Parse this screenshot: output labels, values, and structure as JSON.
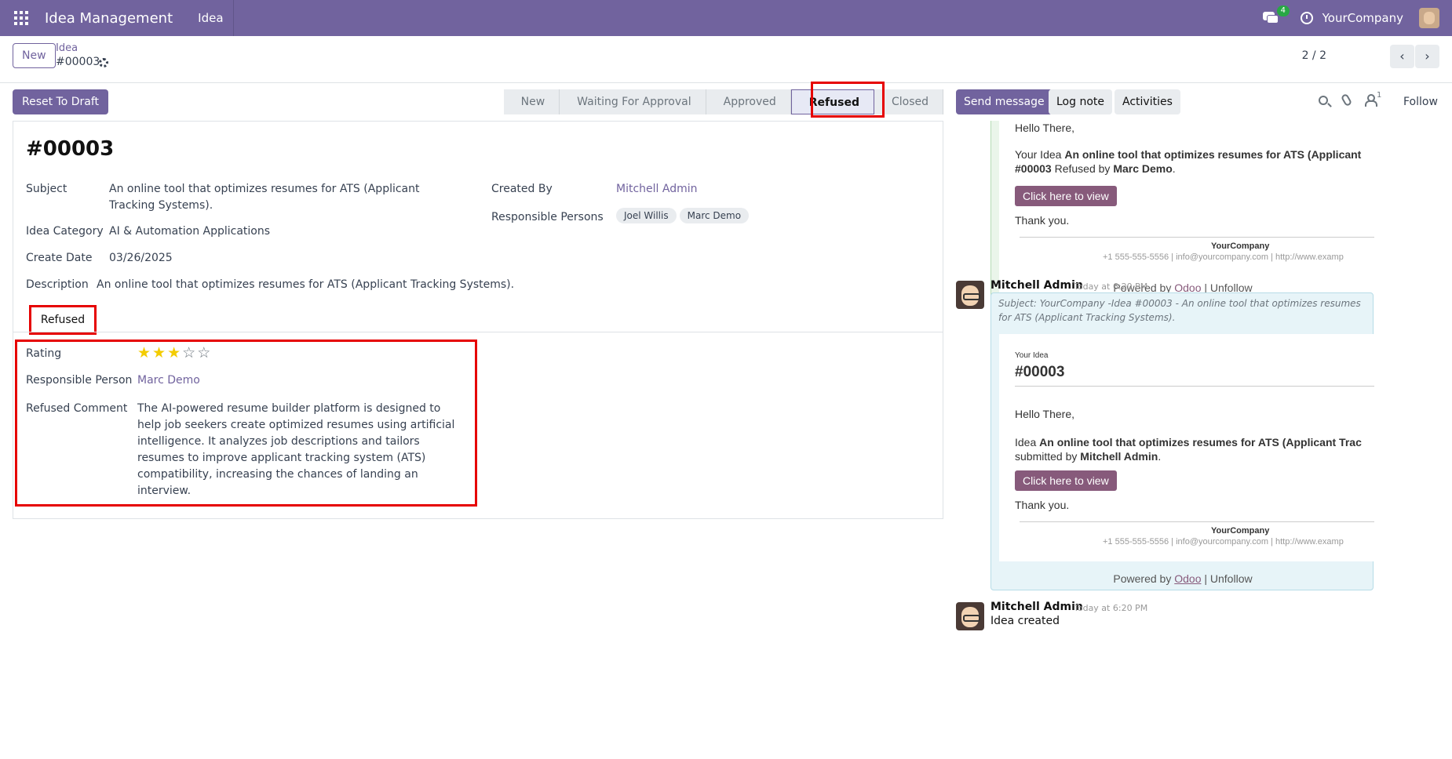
{
  "navbar": {
    "app_name": "Idea Management",
    "menu_item": "Idea",
    "messages_count": "4",
    "company": "YourCompany"
  },
  "control": {
    "new_label": "New",
    "breadcrumb_parent": "Idea",
    "breadcrumb_current": "#00003",
    "pager": "2 / 2"
  },
  "statusbar": {
    "reset_label": "Reset To Draft",
    "stages": [
      "New",
      "Waiting For Approval",
      "Approved",
      "Refused",
      "Closed"
    ],
    "active_stage": "Refused"
  },
  "form": {
    "title": "#00003",
    "subject_label": "Subject",
    "subject_value": "An online tool that optimizes resumes for ATS (Applicant Tracking Systems).",
    "category_label": "Idea Category",
    "category_value": "AI & Automation Applications",
    "create_date_label": "Create Date",
    "create_date_value": "03/26/2025",
    "description_label": "Description",
    "description_value": "An online tool that optimizes resumes for ATS (Applicant Tracking Systems).",
    "created_by_label": "Created By",
    "created_by_value": "Mitchell Admin",
    "responsible_persons_label": "Responsible Persons",
    "responsible_persons": [
      "Joel Willis",
      "Marc Demo"
    ],
    "tab_label": "Refused",
    "rating_label": "Rating",
    "rating_value": 3,
    "rating_max": 5,
    "responsible_person_label": "Responsible Person",
    "responsible_person_value": "Marc Demo",
    "refused_comment_label": "Refused Comment",
    "refused_comment_value": "The AI-powered resume builder platform is designed to help job seekers create optimized resumes using artificial intelligence. It analyzes job descriptions and tailors resumes to improve applicant tracking system (ATS) compatibility, increasing the chances of landing an interview."
  },
  "chatter": {
    "send_message": "Send message",
    "log_note": "Log note",
    "activities": "Activities",
    "follower_count": "1",
    "follow": "Follow",
    "email1": {
      "greeting": "Hello There,",
      "line_prefix": "Your Idea ",
      "line_bold": "An online tool that optimizes resumes for ATS (Applicant",
      "line2_bold": "#00003",
      "line2_mid": " Refused by ",
      "line2_name": "Marc Demo",
      "line2_end": ".",
      "button": "Click here to view",
      "thanks": "Thank you.",
      "company": "YourCompany",
      "contact": "+1 555-555-5556 | info@yourcompany.com | http://www.examp",
      "powered_prefix": "Powered by ",
      "powered_link": "Odoo",
      "powered_suffix": " | Unfollow"
    },
    "message2": {
      "author": "Mitchell Admin",
      "date": "Today at 6:20 PM",
      "subject": "Subject: YourCompany -Idea #00003 - An online tool that optimizes resumes for ATS (Applicant Tracking Systems).",
      "your_idea": "Your Idea",
      "ref": "#00003",
      "greeting": "Hello There,",
      "line_prefix": "Idea ",
      "line_bold": "An online tool that optimizes resumes for ATS (Applicant Trac",
      "line2_prefix": "submitted by ",
      "line2_name": "Mitchell Admin",
      "line2_end": ".",
      "button": "Click here to view",
      "thanks": "Thank you.",
      "company": "YourCompany",
      "contact": "+1 555-555-5556 | info@yourcompany.com | http://www.examp",
      "powered_prefix": "Powered by ",
      "powered_link": "Odoo",
      "powered_suffix": " | Unfollow"
    },
    "message3": {
      "author": "Mitchell Admin",
      "date": "Today at 6:20 PM",
      "body": "Idea created"
    }
  }
}
